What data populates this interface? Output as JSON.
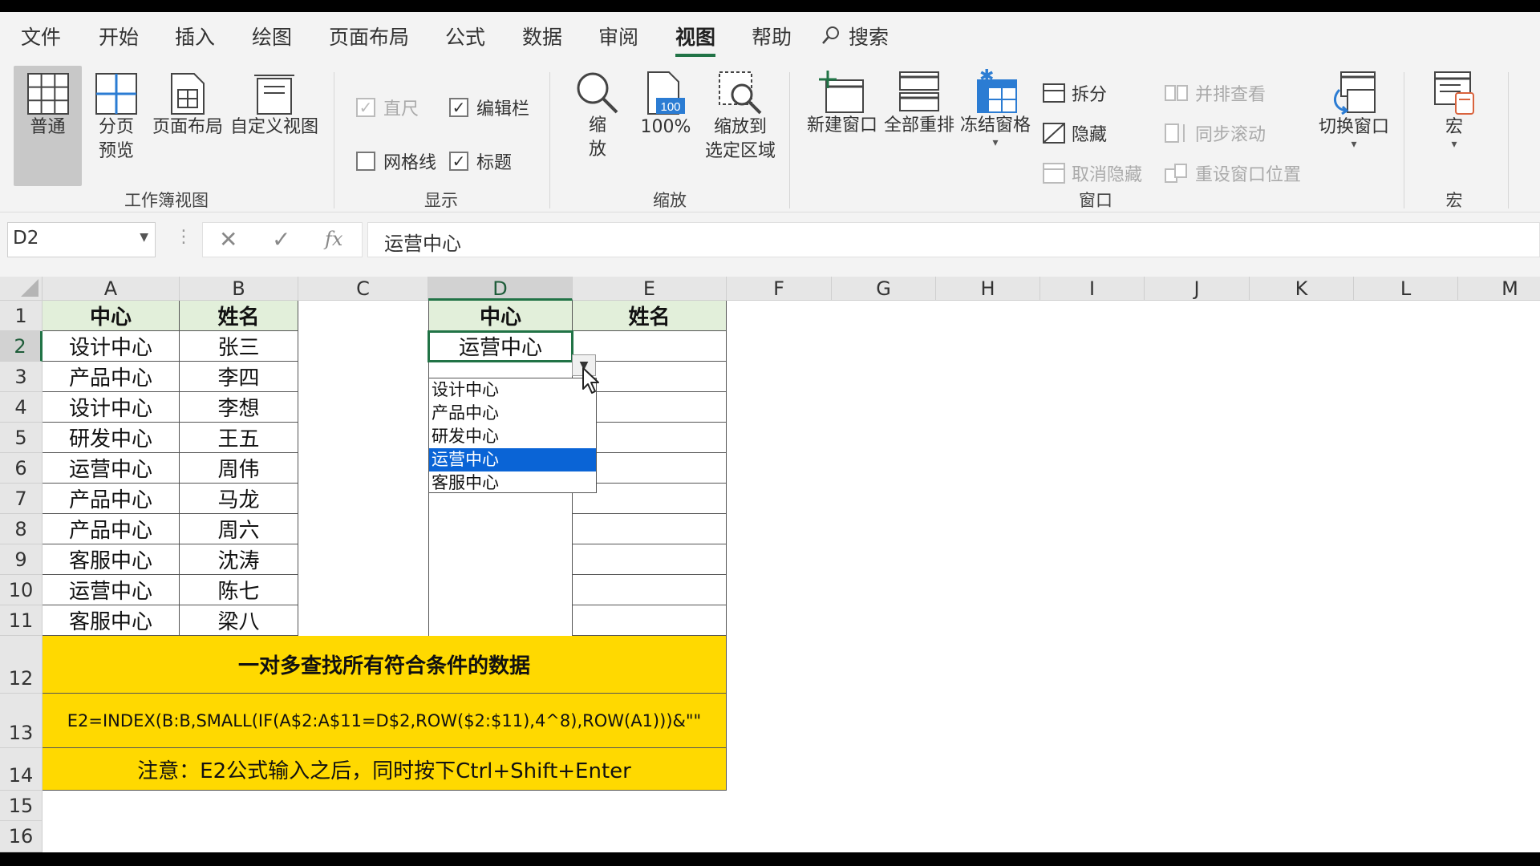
{
  "menu": {
    "tabs": [
      "文件",
      "开始",
      "插入",
      "绘图",
      "页面布局",
      "公式",
      "数据",
      "审阅",
      "视图",
      "帮助"
    ],
    "active": "视图",
    "search_label": "搜索"
  },
  "ribbon": {
    "workbook_views": {
      "label": "工作簿视图",
      "normal": "普通",
      "page_break_line1": "分页",
      "page_break_line2": "预览",
      "page_layout": "页面布局",
      "custom_views": "自定义视图"
    },
    "show": {
      "label": "显示",
      "ruler": "直尺",
      "formula_bar": "编辑栏",
      "gridlines": "网格线",
      "headings": "标题"
    },
    "zoom": {
      "label": "缩放",
      "zoom_line1": "缩",
      "zoom_line2": "放",
      "zoom_100": "100%",
      "icon_badge": "100",
      "zoom_selection_line1": "缩放到",
      "zoom_selection_line2": "选定区域"
    },
    "window": {
      "label": "窗口",
      "new_window": "新建窗口",
      "arrange_all": "全部重排",
      "freeze_panes": "冻结窗格",
      "split": "拆分",
      "hide": "隐藏",
      "unhide": "取消隐藏",
      "view_side_by_side": "并排查看",
      "sync_scroll": "同步滚动",
      "reset_position": "重设窗口位置",
      "switch_windows": "切换窗口"
    },
    "macros": {
      "label": "宏",
      "macros": "宏"
    }
  },
  "formula_bar": {
    "name_box": "D2",
    "fx": "fx",
    "cancel": "✕",
    "enter": "✓",
    "formula": "运营中心"
  },
  "sheet": {
    "columns": [
      "A",
      "B",
      "C",
      "D",
      "E",
      "F",
      "G",
      "H",
      "I",
      "J",
      "K",
      "L",
      "M"
    ],
    "rows": [
      "1",
      "2",
      "3",
      "4",
      "5",
      "6",
      "7",
      "8",
      "9",
      "10",
      "11",
      "12",
      "13",
      "14",
      "15",
      "16"
    ],
    "header_a": "中心",
    "header_b": "姓名",
    "header_d": "中心",
    "header_e": "姓名",
    "data": [
      [
        "设计中心",
        "张三"
      ],
      [
        "产品中心",
        "李四"
      ],
      [
        "设计中心",
        "李想"
      ],
      [
        "研发中心",
        "王五"
      ],
      [
        "运营中心",
        "周伟"
      ],
      [
        "产品中心",
        "马龙"
      ],
      [
        "产品中心",
        "周六"
      ],
      [
        "客服中心",
        "沈涛"
      ],
      [
        "运营中心",
        "陈七"
      ],
      [
        "客服中心",
        "梁八"
      ]
    ],
    "d2_value": "运营中心",
    "dropdown_options": [
      "设计中心",
      "产品中心",
      "研发中心",
      "运营中心",
      "客服中心"
    ],
    "dropdown_selected": "运营中心",
    "title_row": "一对多查找所有符合条件的数据",
    "formula_row": "E2=INDEX(B:B,SMALL(IF(A$2:A$11=D$2,ROW($2:$11),4^8),ROW(A1)))&\"\"",
    "note_row": "注意：E2公式输入之后，同时按下Ctrl+Shift+Enter"
  },
  "colors": {
    "header_fill": "#e2efda",
    "yellow_fill": "#ffd900",
    "accent": "#217346",
    "selection": "#0a64d6"
  }
}
